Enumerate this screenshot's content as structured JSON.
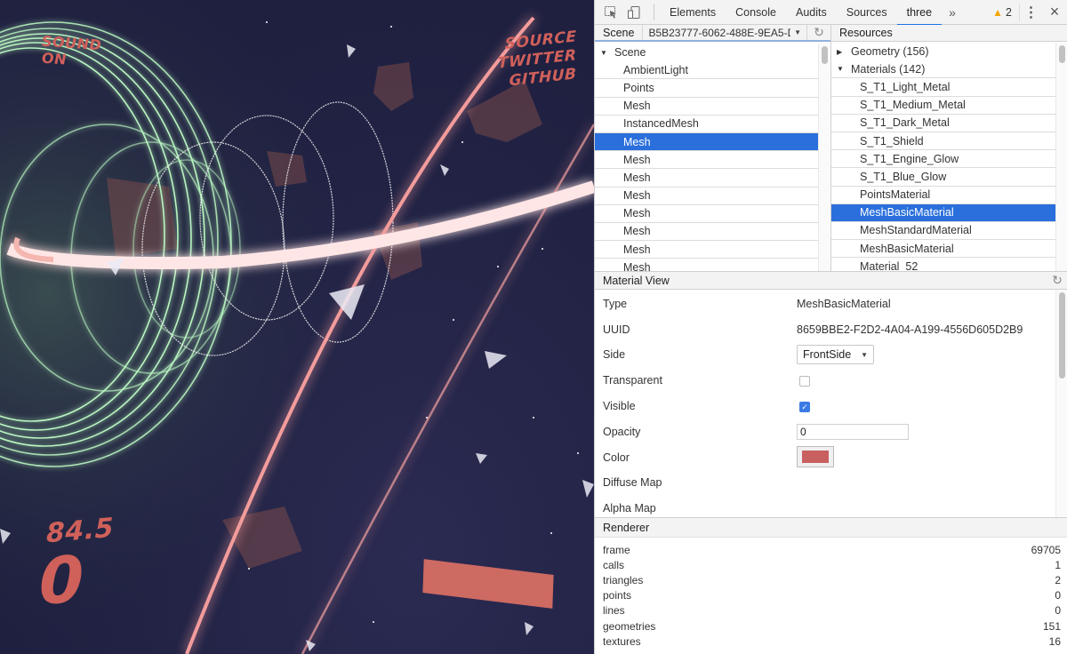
{
  "game": {
    "hud": {
      "sound_line1": "SOUND",
      "sound_line2": "ON",
      "links": [
        "SOURCE",
        "TWITTER",
        "GITHUB"
      ],
      "speed": "84.5",
      "score": "0"
    },
    "colors": {
      "hud": "#d0605a",
      "health_bar": "#cd6a62",
      "tunnel": "#a8f0b0",
      "beam": "#ffd0d0",
      "background": "#22233f"
    }
  },
  "devtools": {
    "toolbar": {
      "tabs": [
        "Elements",
        "Console",
        "Audits",
        "Sources",
        "three"
      ],
      "active_tab": "three",
      "more_label": "»",
      "warnings_count": "2"
    },
    "scene_pane": {
      "label": "Scene",
      "selected_scene": "B5B23777-6062-488E-9EA5-D:",
      "root": "Scene",
      "items": [
        "AmbientLight",
        "Points",
        "Mesh",
        "InstancedMesh",
        "Mesh",
        "Mesh",
        "Mesh",
        "Mesh",
        "Mesh",
        "Mesh",
        "Mesh",
        "Mesh"
      ],
      "selected_index": 4
    },
    "resources_pane": {
      "label": "Resources",
      "geometry_group": "Geometry (156)",
      "materials_group": "Materials (142)",
      "materials": [
        "S_T1_Light_Metal",
        "S_T1_Medium_Metal",
        "S_T1_Dark_Metal",
        "S_T1_Shield",
        "S_T1_Engine_Glow",
        "S_T1_Blue_Glow",
        "PointsMaterial",
        "MeshBasicMaterial",
        "MeshStandardMaterial",
        "MeshBasicMaterial",
        "Material_52"
      ],
      "selected_index": 7
    },
    "material_view": {
      "title": "Material View",
      "type_label": "Type",
      "type_value": "MeshBasicMaterial",
      "uuid_label": "UUID",
      "uuid_value": "8659BBE2-F2D2-4A04-A199-4556D605D2B9",
      "side_label": "Side",
      "side_value": "FrontSide",
      "transparent_label": "Transparent",
      "transparent_checked": false,
      "visible_label": "Visible",
      "visible_checked": true,
      "opacity_label": "Opacity",
      "opacity_value": "0",
      "color_label": "Color",
      "color_value": "#c86060",
      "diffuse_map_label": "Diffuse Map",
      "alpha_map_label": "Alpha Map"
    },
    "renderer": {
      "title": "Renderer",
      "stats": [
        {
          "name": "frame",
          "value": "69705"
        },
        {
          "name": "calls",
          "value": "1"
        },
        {
          "name": "triangles",
          "value": "2"
        },
        {
          "name": "points",
          "value": "0"
        },
        {
          "name": "lines",
          "value": "0"
        },
        {
          "name": "geometries",
          "value": "151"
        },
        {
          "name": "textures",
          "value": "16"
        }
      ]
    },
    "colors": {
      "selection": "#2a6fdc",
      "active_tab_underline": "#1a73e8",
      "warning": "#f2a600"
    }
  }
}
